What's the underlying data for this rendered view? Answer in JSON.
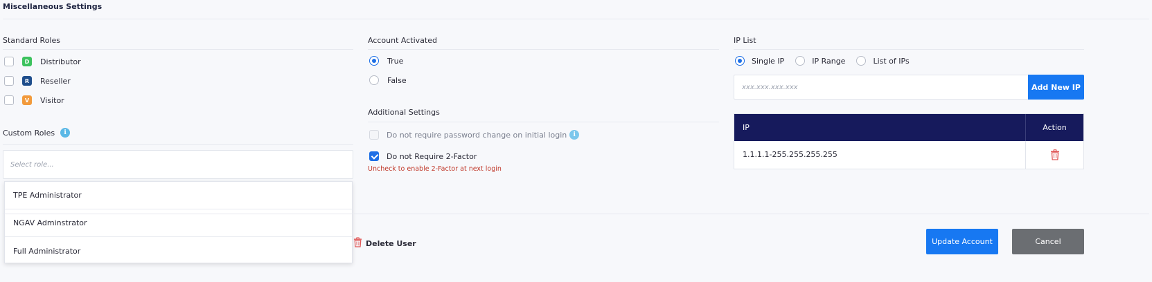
{
  "section": {
    "title": "Miscellaneous Settings"
  },
  "standard_roles": {
    "heading": "Standard Roles",
    "items": [
      {
        "badge": "D",
        "label": "Distributor",
        "color": "#3cc25e"
      },
      {
        "badge": "R",
        "label": "Reseller",
        "color": "#1f4e8c"
      },
      {
        "badge": "V",
        "label": "Visitor",
        "color": "#f29a3c"
      }
    ]
  },
  "custom_roles": {
    "heading": "Custom Roles",
    "info_glyph": "i",
    "placeholder": "Select role...",
    "options": [
      "TPE Administrator",
      "NGAV Adminstrator",
      "Full Administrator"
    ]
  },
  "account_activated": {
    "heading": "Account Activated",
    "options": [
      {
        "label": "True",
        "selected": true
      },
      {
        "label": "False",
        "selected": false
      }
    ]
  },
  "additional_settings": {
    "heading": "Additional Settings",
    "password_change_label": "Do not require password change on initial login",
    "password_info_glyph": "i",
    "two_factor_label": "Do not Require 2-Factor",
    "two_factor_hint": "Uncheck to enable 2-Factor at next login"
  },
  "ip_list": {
    "heading": "IP List",
    "modes": [
      {
        "label": "Single IP",
        "selected": true
      },
      {
        "label": "IP Range",
        "selected": false
      },
      {
        "label": "List of IPs",
        "selected": false
      }
    ],
    "input_placeholder": "xxx.xxx.xxx.xxx",
    "add_button": "Add New IP",
    "table": {
      "col_ip": "IP",
      "col_action": "Action",
      "rows": [
        {
          "ip": "1.1.1.1-255.255.255.255"
        }
      ]
    }
  },
  "footer": {
    "delete_user": "Delete User",
    "update_button": "Update Account",
    "cancel_button": "Cancel"
  },
  "colors": {
    "primary": "#1778f2",
    "table_header": "#161a5c",
    "danger": "#e05555",
    "cancel": "#6b6e72"
  }
}
